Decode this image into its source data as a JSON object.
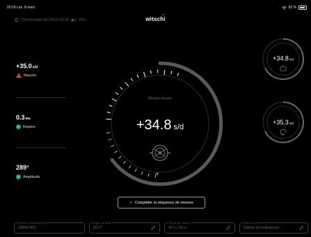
{
  "status_bar": {
    "time": "20:59",
    "date": "Lun. 8 mars",
    "battery": "82 %"
  },
  "device": {
    "name": "Chronomaster Air 00013 V0.90",
    "battery": "36%"
  },
  "brand": "witschi",
  "metrics": [
    {
      "value": "+35.0",
      "unit": "s/d",
      "label": "Marche",
      "status": "warning"
    },
    {
      "value": "0.3",
      "unit": "ms",
      "label": "Repère",
      "status": "ok"
    },
    {
      "value": "289°",
      "unit": "",
      "label": "Amplitude",
      "status": "ok"
    }
  ],
  "main_dial": {
    "status": "Mesure réussie",
    "value": "+34.8",
    "unit": "s/d"
  },
  "side_dials": [
    {
      "value": "+34.8",
      "unit": "s/d"
    },
    {
      "value": "+35.3",
      "unit": "s/d"
    }
  ],
  "complete_button": "Compléter la séquence de mesure",
  "fields": [
    {
      "label": "Nombre d'alternances",
      "value": "28800 A/h",
      "editable": false
    },
    {
      "label": "Angle de levée",
      "value": "50.0°",
      "editable": true
    },
    {
      "label": "Temps de mesure",
      "value": "40 s / 20 s",
      "editable": true
    },
    {
      "label": "Tolérances",
      "value": "Définir les tolérances",
      "editable": true
    }
  ],
  "colors": {
    "accent_green": "#2aa56a",
    "warning_red": "#d0453f",
    "arc_grey": "#5a5a5a"
  }
}
